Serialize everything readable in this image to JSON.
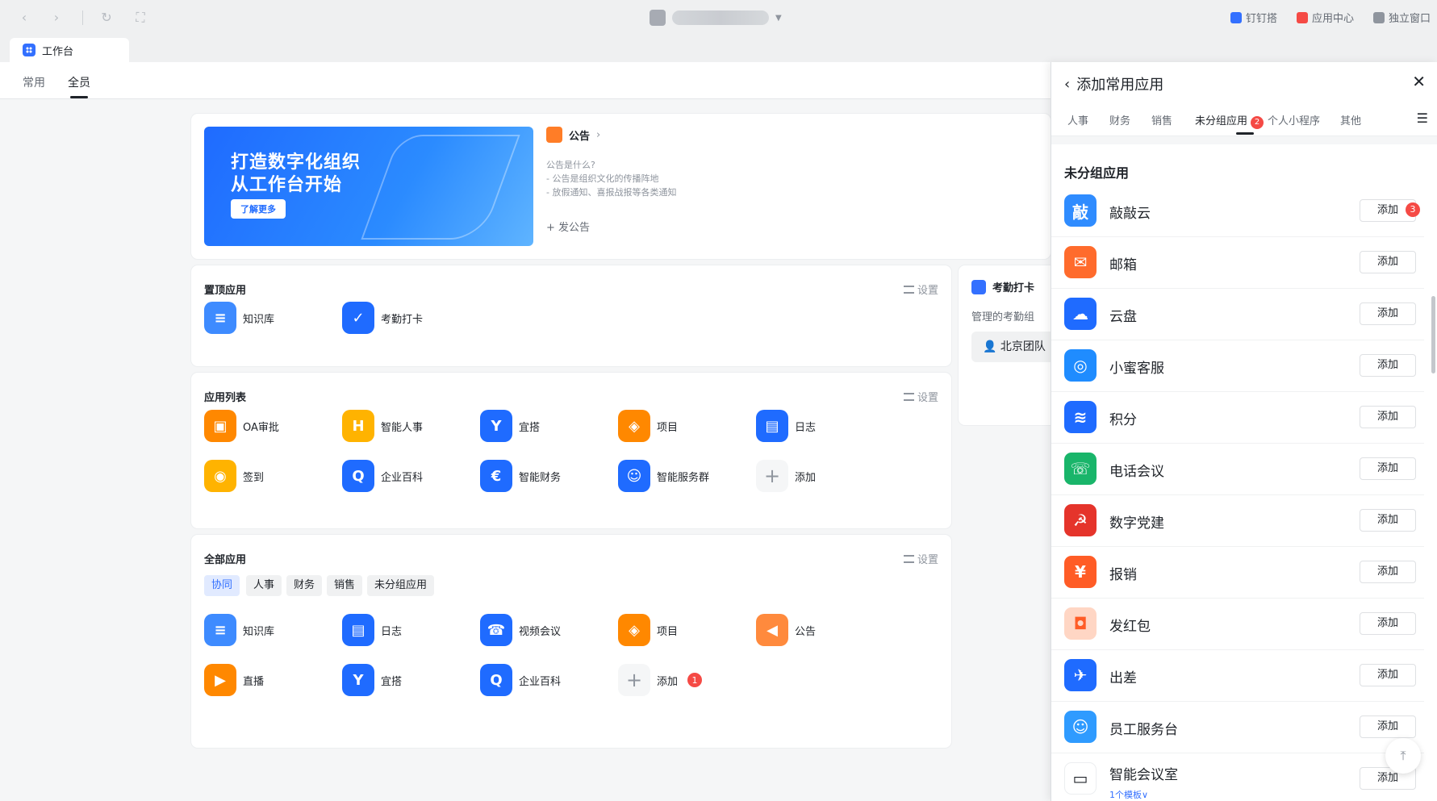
{
  "topbar": {
    "links": [
      {
        "label": "钉钉搭",
        "icon": "dingda-icon",
        "color": "#3370ff"
      },
      {
        "label": "应用中心",
        "icon": "app-center-icon",
        "color": "#f54a45"
      },
      {
        "label": "独立窗口",
        "icon": "window-icon",
        "color": "#8f959e"
      }
    ]
  },
  "tab": {
    "title": "工作台"
  },
  "subnav": {
    "tabs": [
      "常用",
      "全员"
    ],
    "active": "全员"
  },
  "banner": {
    "line1": "打造数字化组织",
    "line2": "从工作台开始",
    "button": "了解更多"
  },
  "announcement": {
    "title": "公告",
    "lines": [
      "公告是什么?",
      "- 公告是组织文化的传播阵地",
      "- 放假通知、喜报战报等各类通知"
    ],
    "post": "+ 发公告"
  },
  "pinned": {
    "title": "置顶应用",
    "settings": "设置",
    "apps": [
      {
        "label": "知识库",
        "color": "#3e8bff",
        "glyph": "≡"
      },
      {
        "label": "考勤打卡",
        "color": "#1f6bff",
        "glyph": "✓"
      }
    ]
  },
  "applist": {
    "title": "应用列表",
    "settings": "设置",
    "apps": [
      {
        "label": "OA审批",
        "color": "#ff8800",
        "glyph": "▣"
      },
      {
        "label": "智能人事",
        "color": "#ffb300",
        "glyph": "H"
      },
      {
        "label": "宜搭",
        "color": "#1f6bff",
        "glyph": "Y"
      },
      {
        "label": "项目",
        "color": "#ff8800",
        "glyph": "◈"
      },
      {
        "label": "日志",
        "color": "#1f6bff",
        "glyph": "▤"
      },
      {
        "label": "签到",
        "color": "#ffb300",
        "glyph": "◉"
      },
      {
        "label": "企业百科",
        "color": "#1f6bff",
        "glyph": "Q"
      },
      {
        "label": "智能财务",
        "color": "#1f6bff",
        "glyph": "€"
      },
      {
        "label": "智能服务群",
        "color": "#1f6bff",
        "glyph": "☺"
      },
      {
        "label": "添加",
        "color": "#f5f6f7",
        "glyph": "+"
      }
    ]
  },
  "allapps": {
    "title": "全部应用",
    "settings": "设置",
    "filters": [
      "协同",
      "人事",
      "财务",
      "销售",
      "未分组应用"
    ],
    "active_filter": "协同",
    "apps": [
      {
        "label": "知识库",
        "color": "#3e8bff",
        "glyph": "≡"
      },
      {
        "label": "日志",
        "color": "#1f6bff",
        "glyph": "▤"
      },
      {
        "label": "视频会议",
        "color": "#1f6bff",
        "glyph": "☎"
      },
      {
        "label": "项目",
        "color": "#ff8800",
        "glyph": "◈"
      },
      {
        "label": "公告",
        "color": "#ff8a3d",
        "glyph": "◀"
      },
      {
        "label": "直播",
        "color": "#ff8800",
        "glyph": "▶"
      },
      {
        "label": "宜搭",
        "color": "#1f6bff",
        "glyph": "Y"
      },
      {
        "label": "企业百科",
        "color": "#1f6bff",
        "glyph": "Q"
      },
      {
        "label": "添加",
        "color": "#f5f6f7",
        "glyph": "+",
        "badge": "1"
      }
    ]
  },
  "attendance": {
    "title": "考勤打卡",
    "subtitle": "管理的考勤组",
    "group": "北京团队"
  },
  "panel": {
    "title": "添加常用应用",
    "tabs": [
      "人事",
      "财务",
      "销售",
      "未分组应用",
      "个人小程序",
      "其他"
    ],
    "active_tab": "未分组应用",
    "active_badge": "2",
    "section": "未分组应用",
    "add_label": "添加",
    "items": [
      {
        "name": "敲敲云",
        "color": "#2f8cff",
        "glyph": "敲",
        "badge": "3"
      },
      {
        "name": "邮箱",
        "color": "#ff6b2c",
        "glyph": "✉"
      },
      {
        "name": "云盘",
        "color": "#1f6bff",
        "glyph": "☁"
      },
      {
        "name": "小蜜客服",
        "color": "#1f8cff",
        "glyph": "◎"
      },
      {
        "name": "积分",
        "color": "#1f6bff",
        "glyph": "≋"
      },
      {
        "name": "电话会议",
        "color": "#19b56a",
        "glyph": "☏"
      },
      {
        "name": "数字党建",
        "color": "#e5342b",
        "glyph": "☭"
      },
      {
        "name": "报销",
        "color": "#ff5c26",
        "glyph": "¥"
      },
      {
        "name": "发红包",
        "color": "#ffd6c4",
        "glyph": "◘"
      },
      {
        "name": "出差",
        "color": "#1f6bff",
        "glyph": "✈"
      },
      {
        "name": "员工服务台",
        "color": "#2f9bff",
        "glyph": "☺"
      },
      {
        "name": "智能会议室",
        "color": "#ffffff",
        "glyph": "▭",
        "sub": "1个模板∨"
      }
    ]
  }
}
